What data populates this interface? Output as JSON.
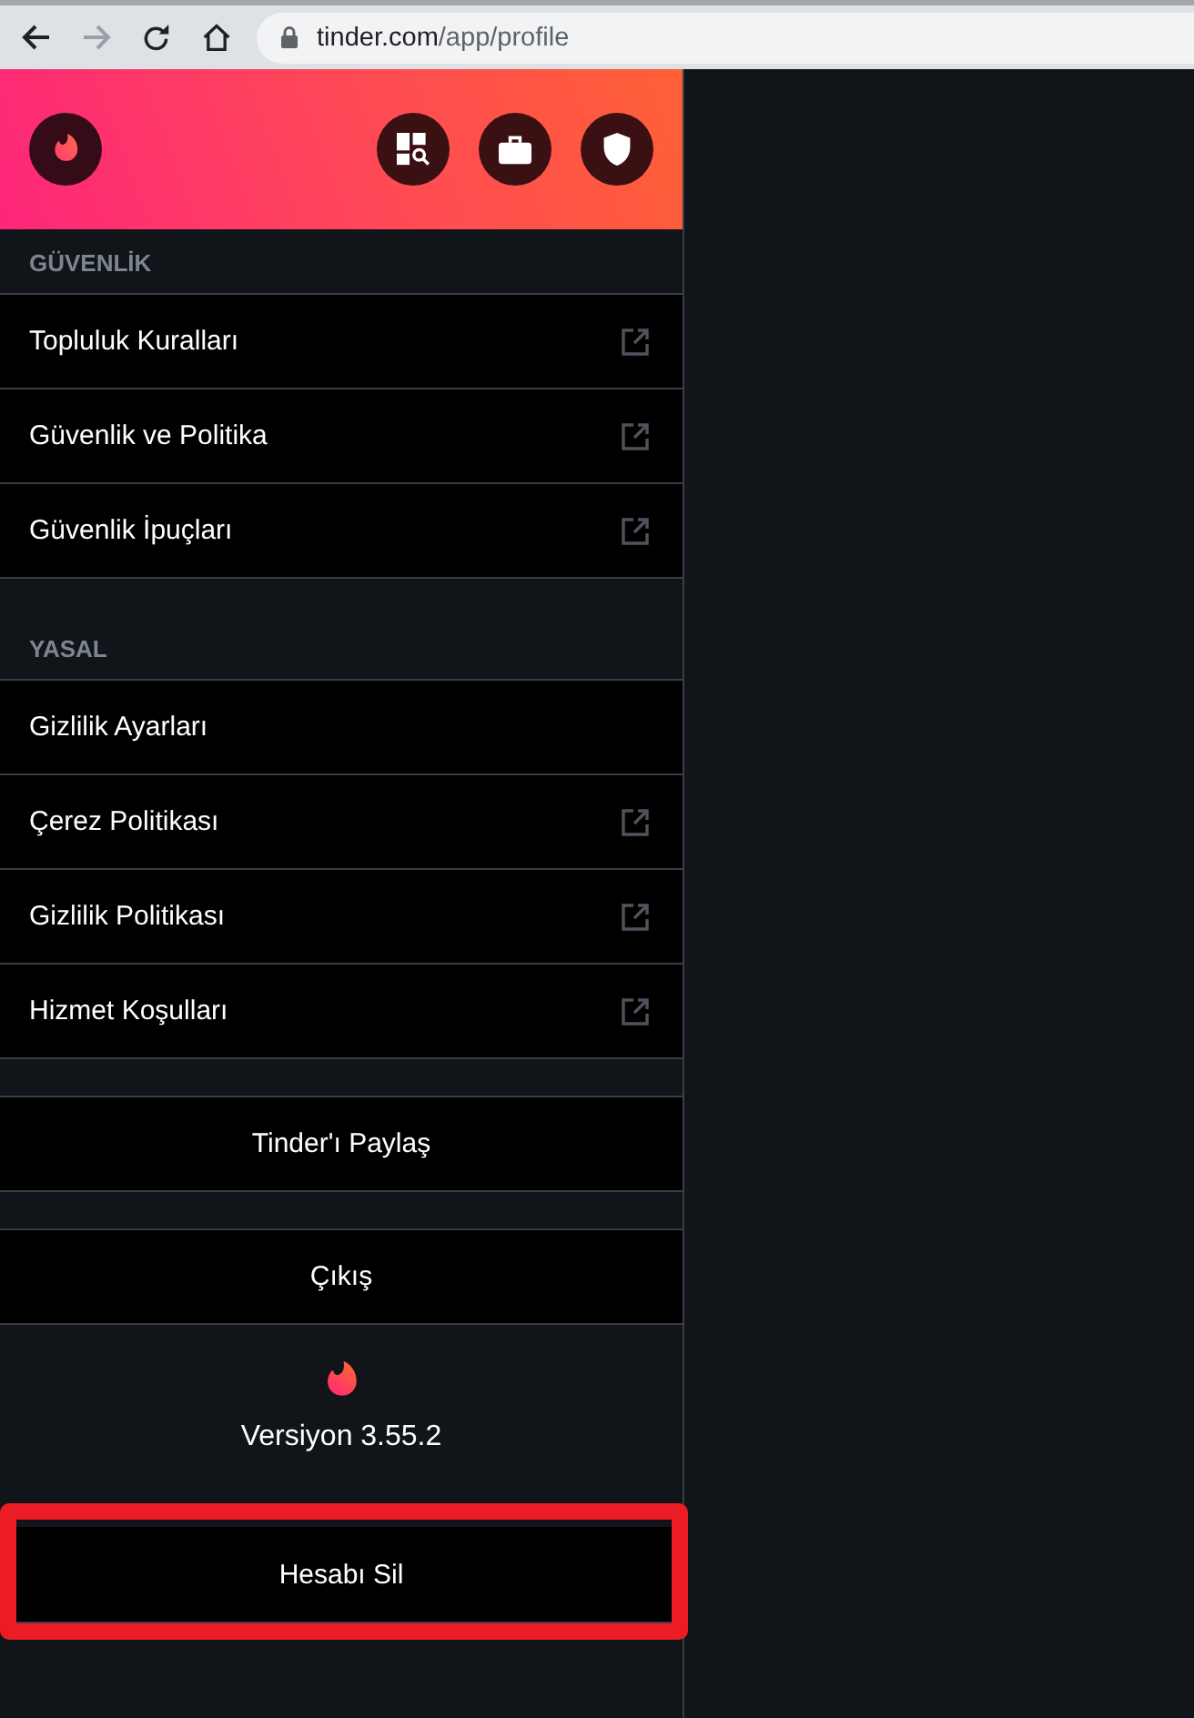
{
  "browser": {
    "nav_buttons": [
      {
        "kind": "back",
        "disabled": false
      },
      {
        "kind": "forward",
        "disabled": true
      },
      {
        "kind": "reload",
        "disabled": false
      },
      {
        "kind": "home",
        "disabled": false
      }
    ],
    "address_bar": {
      "secure": true,
      "host": "tinder.com",
      "path": "/app/profile"
    }
  },
  "header": {
    "actions": [
      {
        "kind": "explore"
      },
      {
        "kind": "shop"
      },
      {
        "kind": "safety"
      }
    ]
  },
  "sections": [
    {
      "title": "GÜVENLİK",
      "items": [
        {
          "label": "Topluluk Kuralları",
          "external": true
        },
        {
          "label": "Güvenlik ve Politika",
          "external": true
        },
        {
          "label": "Güvenlik İpuçları",
          "external": true
        }
      ]
    },
    {
      "title": "YASAL",
      "items": [
        {
          "label": "Gizlilik Ayarları",
          "external": false
        },
        {
          "label": "Çerez Politikası",
          "external": true
        },
        {
          "label": "Gizlilik Politikası",
          "external": true
        },
        {
          "label": "Hizmet Koşulları",
          "external": true
        }
      ]
    }
  ],
  "buttons": [
    {
      "label": "Tinder'ı Paylaş"
    },
    {
      "label": "Çıkış"
    }
  ],
  "version": "Versiyon 3.55.2",
  "delete_button": {
    "label": "Hesabı Sil",
    "highlighted": true
  }
}
